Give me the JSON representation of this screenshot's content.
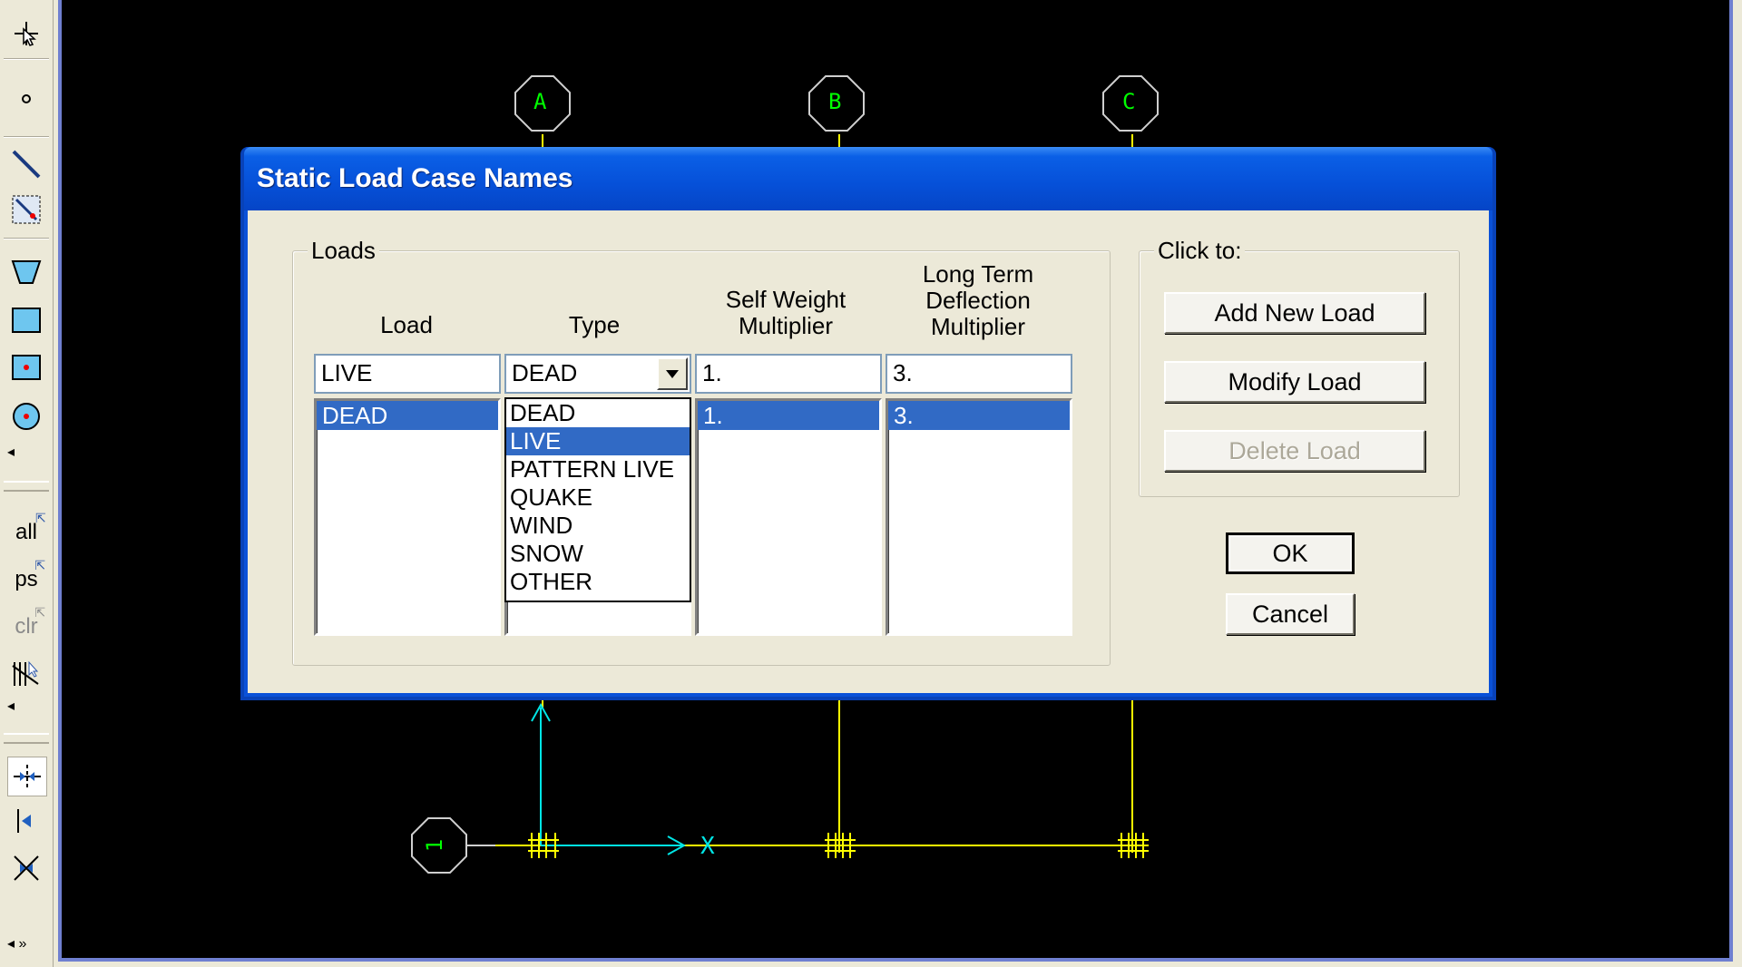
{
  "dialog": {
    "title": "Static Load Case Names",
    "loads_group_label": "Loads",
    "columns": {
      "load": "Load",
      "type": "Type",
      "self_weight": [
        "Self Weight",
        "Multiplier"
      ],
      "long_term": [
        "Long Term",
        "Deflection",
        "Multiplier"
      ]
    },
    "inputs": {
      "load": "LIVE",
      "type": "DEAD",
      "self_weight": "1.",
      "long_term": "3."
    },
    "list_rows": [
      {
        "load": "DEAD",
        "self_weight": "1.",
        "long_term": "3.",
        "selected": true
      }
    ],
    "type_options": [
      "DEAD",
      "LIVE",
      "PATTERN LIVE",
      "QUAKE",
      "WIND",
      "SNOW",
      "OTHER"
    ],
    "type_options_highlighted": "LIVE",
    "click_group_label": "Click to:",
    "buttons": {
      "add": "Add New Load",
      "modify": "Modify Load",
      "delete": "Delete Load",
      "ok": "OK",
      "cancel": "Cancel"
    }
  },
  "toolbar": {
    "all_label": "all",
    "ps_label": "ps",
    "clr_label": "clr"
  },
  "grid": {
    "bubbles_top": [
      "A",
      "B",
      "C"
    ],
    "bubble_left": "1",
    "axis_x_label": "X"
  },
  "colors": {
    "grid_lines": "#ffff00",
    "axis": "#00e5e5",
    "bubble_text": "#00ff00",
    "selection": "#316ac5",
    "title_bar": "#0a5fe6"
  }
}
